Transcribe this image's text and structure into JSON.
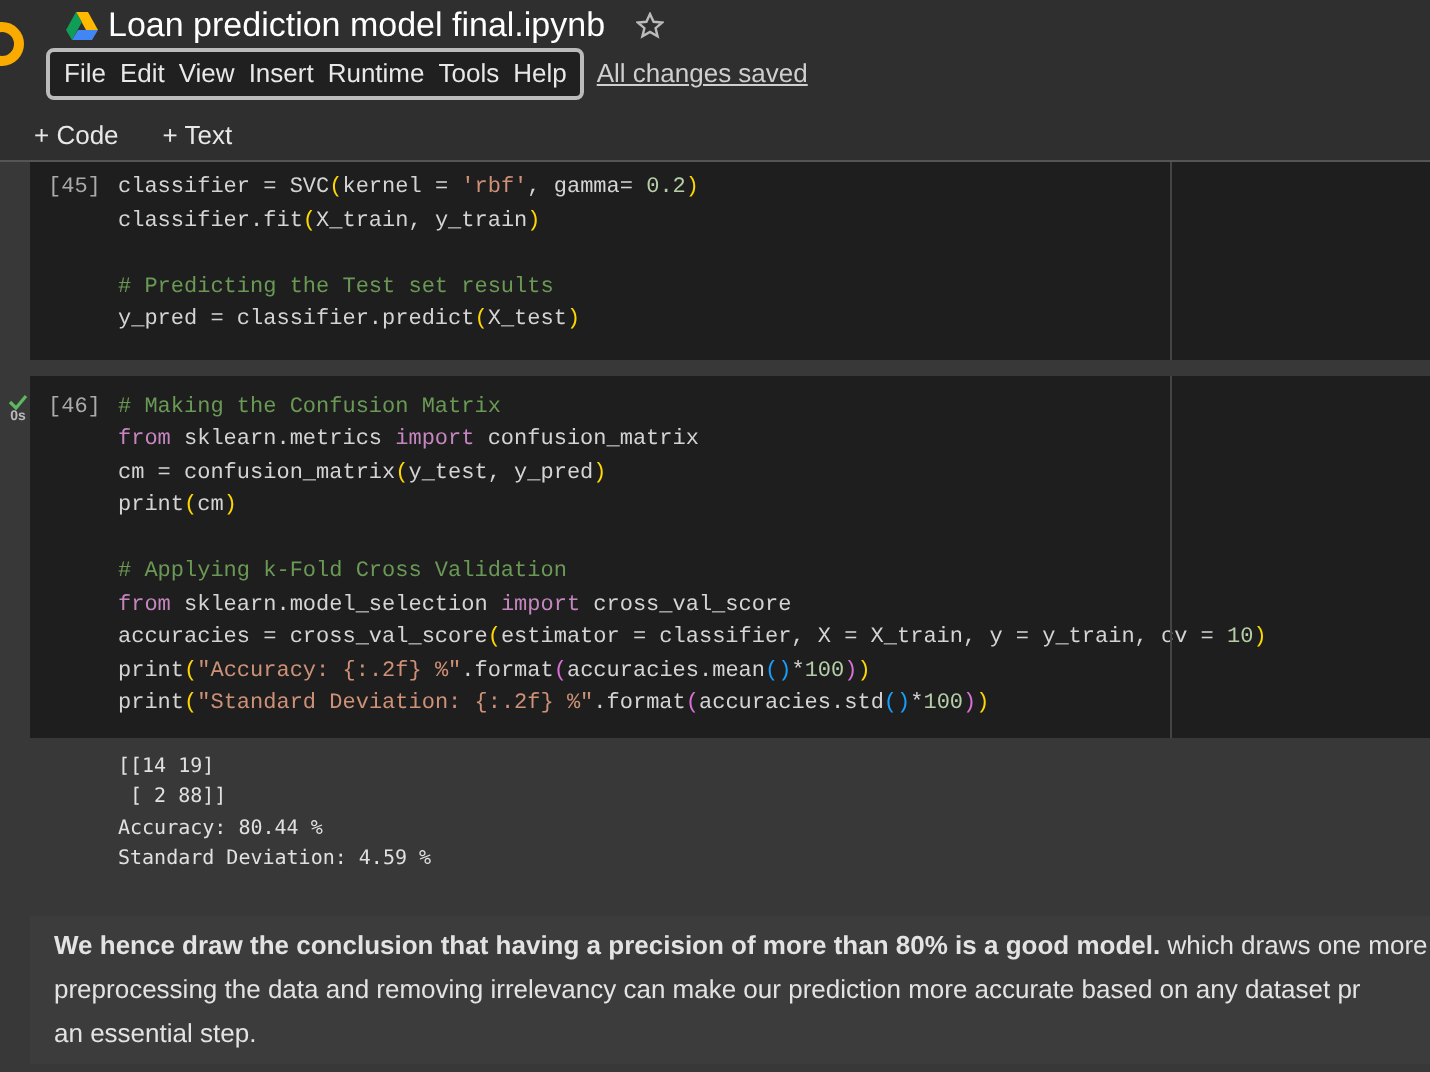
{
  "header": {
    "title": "Loan prediction model final.ipynb",
    "starred": false,
    "menu": [
      "File",
      "Edit",
      "View",
      "Insert",
      "Runtime",
      "Tools",
      "Help"
    ],
    "save_status": "All changes saved"
  },
  "toolbar": [
    "+ Code",
    "+ Text"
  ],
  "cells": [
    {
      "count": "[45]",
      "ran": false,
      "blocks": [
        [
          [
            {
              "t": "classifier = SVC",
              "kind": "plain"
            },
            {
              "t": "(",
              "kind": "p1"
            },
            {
              "t": "kernel = ",
              "kind": "plain"
            },
            {
              "t": "'rbf'",
              "kind": "str"
            },
            {
              "t": ", gamma= ",
              "kind": "plain"
            },
            {
              "t": "0.2",
              "kind": "num"
            },
            {
              "t": ")",
              "kind": "p1"
            }
          ],
          [
            {
              "t": "classifier.fit",
              "kind": "plain"
            },
            {
              "t": "(",
              "kind": "p1"
            },
            {
              "t": "X_train, y_train",
              "kind": "plain"
            },
            {
              "t": ")",
              "kind": "p1"
            }
          ]
        ],
        [
          [
            {
              "t": "# Predicting the Test set results",
              "kind": "comment"
            }
          ],
          [
            {
              "t": "y_pred = classifier.predict",
              "kind": "plain"
            },
            {
              "t": "(",
              "kind": "p1"
            },
            {
              "t": "X_test",
              "kind": "plain"
            },
            {
              "t": ")",
              "kind": "p1"
            }
          ]
        ]
      ]
    },
    {
      "count": "[46]",
      "ran": true,
      "elapsed": "0s",
      "blocks": [
        [
          [
            {
              "t": "# Making the Confusion Matrix",
              "kind": "comment"
            }
          ],
          [
            {
              "t": "from",
              "kind": "kw"
            },
            {
              "t": " sklearn.metrics ",
              "kind": "plain"
            },
            {
              "t": "import",
              "kind": "kw"
            },
            {
              "t": " confusion_matrix",
              "kind": "plain"
            }
          ],
          [
            {
              "t": "cm = confusion_matrix",
              "kind": "plain"
            },
            {
              "t": "(",
              "kind": "p1"
            },
            {
              "t": "y_test, y_pred",
              "kind": "plain"
            },
            {
              "t": ")",
              "kind": "p1"
            }
          ],
          [
            {
              "t": "print",
              "kind": "plain"
            },
            {
              "t": "(",
              "kind": "p1"
            },
            {
              "t": "cm",
              "kind": "plain"
            },
            {
              "t": ")",
              "kind": "p1"
            }
          ]
        ],
        [
          [
            {
              "t": "# Applying k-Fold Cross Validation",
              "kind": "comment"
            }
          ],
          [
            {
              "t": "from",
              "kind": "kw"
            },
            {
              "t": " sklearn.model_selection ",
              "kind": "plain"
            },
            {
              "t": "import",
              "kind": "kw"
            },
            {
              "t": " cross_val_score",
              "kind": "plain"
            }
          ],
          [
            {
              "t": "accuracies = cross_val_score",
              "kind": "plain"
            },
            {
              "t": "(",
              "kind": "p1"
            },
            {
              "t": "estimator = classifier, X = X_train, y = y_train, cv = ",
              "kind": "plain"
            },
            {
              "t": "10",
              "kind": "num"
            },
            {
              "t": ")",
              "kind": "p1"
            }
          ],
          [
            {
              "t": "print",
              "kind": "plain"
            },
            {
              "t": "(",
              "kind": "p1"
            },
            {
              "t": "\"Accuracy: {:.2f} %\"",
              "kind": "str"
            },
            {
              "t": ".format",
              "kind": "plain"
            },
            {
              "t": "(",
              "kind": "p2"
            },
            {
              "t": "accuracies.mean",
              "kind": "plain"
            },
            {
              "t": "()",
              "kind": "p3"
            },
            {
              "t": "*",
              "kind": "plain"
            },
            {
              "t": "100",
              "kind": "num"
            },
            {
              "t": ")",
              "kind": "p2"
            },
            {
              "t": ")",
              "kind": "p1"
            }
          ],
          [
            {
              "t": "print",
              "kind": "plain"
            },
            {
              "t": "(",
              "kind": "p1"
            },
            {
              "t": "\"Standard Deviation: {:.2f} %\"",
              "kind": "str"
            },
            {
              "t": ".format",
              "kind": "plain"
            },
            {
              "t": "(",
              "kind": "p2"
            },
            {
              "t": "accuracies.std",
              "kind": "plain"
            },
            {
              "t": "()",
              "kind": "p3"
            },
            {
              "t": "*",
              "kind": "plain"
            },
            {
              "t": "100",
              "kind": "num"
            },
            {
              "t": ")",
              "kind": "p2"
            },
            {
              "t": ")",
              "kind": "p1"
            }
          ]
        ]
      ],
      "output": [
        "[[14 19]",
        " [ 2 88]]",
        "Accuracy: 80.44 %",
        "Standard Deviation: 4.59 %"
      ]
    }
  ],
  "text_cell": {
    "lines": [
      "**We hence draw the conclusion that having a precision of more than 80% is a good model.** which draws one more",
      "preprocessing the data and removing irrelevancy can make our prediction more accurate based on any dataset pr",
      "an essential step."
    ]
  }
}
